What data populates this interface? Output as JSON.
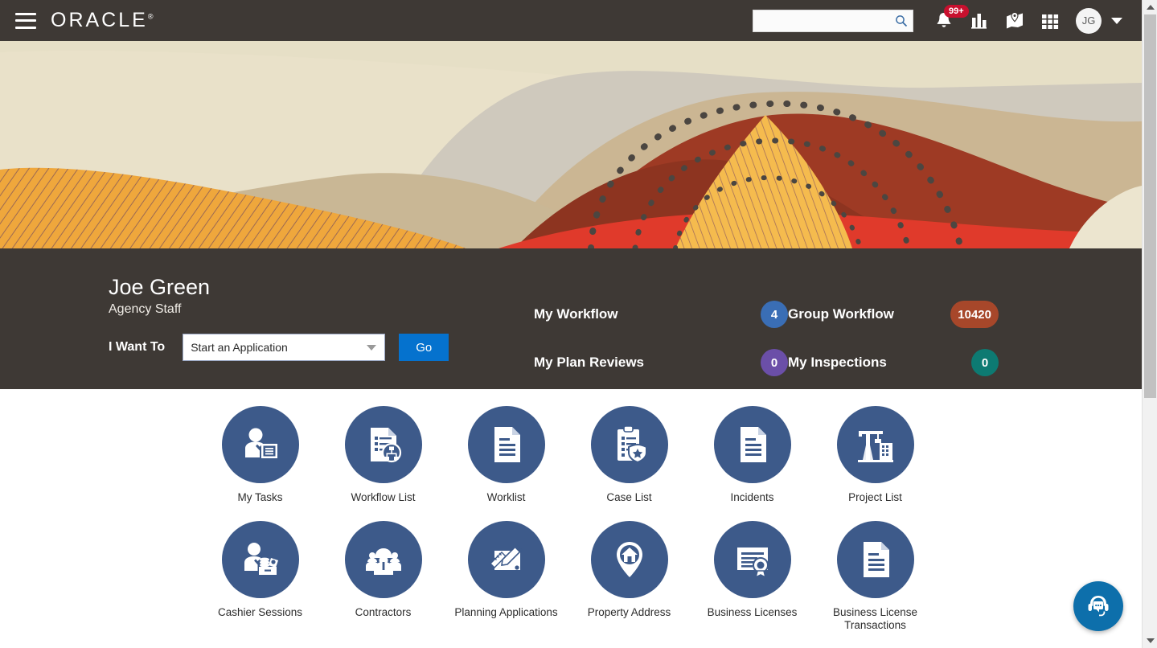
{
  "header": {
    "menu_icon": "hamburger-menu-icon",
    "brand": "ORACLE",
    "brand_mark": "®",
    "search": {
      "value": "",
      "placeholder": "",
      "icon": "search-icon"
    },
    "notifications": {
      "icon": "bell-icon",
      "badge": "99+"
    },
    "reports_icon": "bar-chart-icon",
    "map_icon": "map-icon",
    "apps_icon": "grid-apps-icon",
    "avatar_initials": "JG",
    "caret_icon": "chevron-down-icon"
  },
  "banner": {
    "name": "desert-landscape-artwork"
  },
  "user": {
    "name": "Joe Green",
    "role": "Agency Staff",
    "i_want_to_label": "I Want To",
    "action_select": {
      "value": "Start an Application",
      "caret": "chevron-down-icon"
    },
    "go_button": "Go"
  },
  "counters": [
    {
      "label": "My Workflow",
      "value": "4",
      "color": "#3a6eb5"
    },
    {
      "label": "Group Workflow",
      "value": "10420",
      "color": "#a7472a"
    },
    {
      "label": "My Plan Reviews",
      "value": "0",
      "color": "#6b4fa8"
    },
    {
      "label": "My Inspections",
      "value": "0",
      "color": "#0d7a72"
    }
  ],
  "tiles": {
    "circle_color": "#3d5a8a",
    "row1": [
      {
        "label": "My Tasks",
        "icon": "person-with-list-icon"
      },
      {
        "label": "Workflow List",
        "icon": "document-workflow-icon"
      },
      {
        "label": "Worklist",
        "icon": "document-lines-icon"
      },
      {
        "label": "Case List",
        "icon": "clipboard-badge-icon"
      },
      {
        "label": "Incidents",
        "icon": "document-page-icon"
      },
      {
        "label": "Project List",
        "icon": "crane-buildings-icon"
      }
    ],
    "row2": [
      {
        "label": "Cashier Sessions",
        "icon": "cashier-money-icon"
      },
      {
        "label": "Contractors",
        "icon": "hardhat-workers-icon"
      },
      {
        "label": "Planning Applications",
        "icon": "ruler-pencil-icon"
      },
      {
        "label": "Property Address",
        "icon": "map-pin-house-icon"
      },
      {
        "label": "Business Licenses",
        "icon": "certificate-seal-icon"
      },
      {
        "label": "Business License Transactions",
        "icon": "document-page-icon"
      }
    ]
  },
  "chat": {
    "icon": "headset-chat-icon",
    "color": "#0d6fab"
  },
  "scrollbar": {
    "up_icon": "scroll-up-arrow-icon",
    "down_icon": "scroll-down-arrow-icon"
  }
}
